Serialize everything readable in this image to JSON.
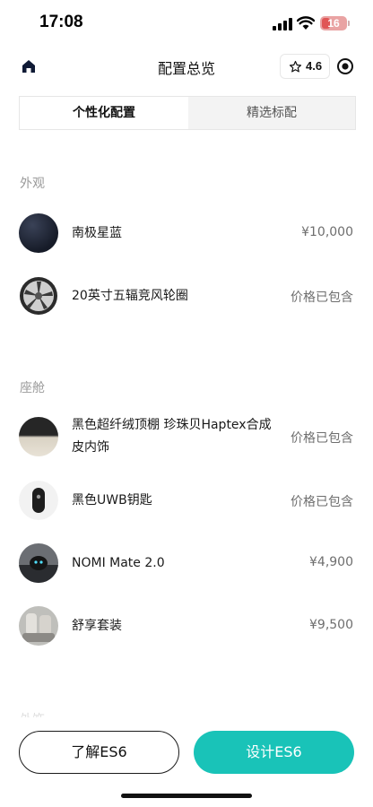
{
  "status_bar": {
    "time": "17:08",
    "battery": "16"
  },
  "nav": {
    "title": "配置总览",
    "rating": "4.6"
  },
  "tabs": [
    {
      "label": "个性化配置",
      "active": true
    },
    {
      "label": "精选标配",
      "active": false
    }
  ],
  "sections": [
    {
      "title": "外观",
      "items": [
        {
          "name": "南极星蓝",
          "price": "¥10,000",
          "icon": "paint-swatch-icon"
        },
        {
          "name": "20英寸五辐竞风轮圈",
          "price": "价格已包含",
          "icon": "wheel-icon"
        }
      ]
    },
    {
      "title": "座舱",
      "items": [
        {
          "name": "黑色超纤绒顶棚 珍珠贝Haptex合成皮内饰",
          "price": "价格已包含",
          "icon": "interior-swatch-icon"
        },
        {
          "name": "黑色UWB钥匙",
          "price": "价格已包含",
          "icon": "key-fob-icon"
        },
        {
          "name": "NOMI Mate 2.0",
          "price": "¥4,900",
          "icon": "nomi-icon"
        },
        {
          "name": "舒享套装",
          "price": "¥9,500",
          "icon": "seat-icon"
        }
      ]
    },
    {
      "title": "外饰"
    }
  ],
  "buttons": {
    "learn": "了解ES6",
    "design": "设计ES6"
  },
  "colors": {
    "accent": "#19c3b8",
    "paint": "#1b2233"
  }
}
